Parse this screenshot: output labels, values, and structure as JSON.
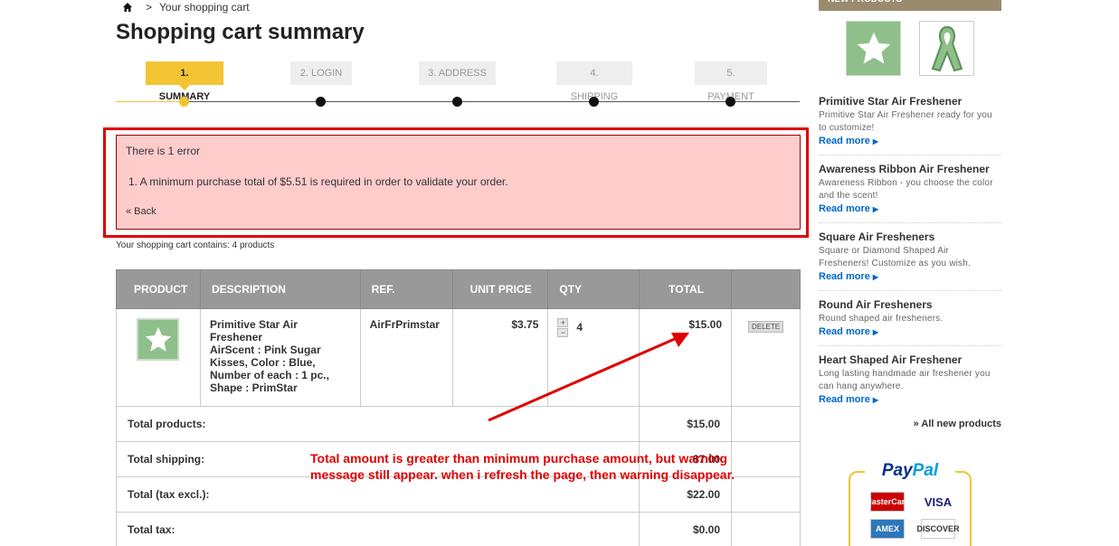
{
  "breadcrumb": {
    "separator": ">",
    "current": "Your shopping cart"
  },
  "page_title": "Shopping cart summary",
  "steps": [
    "1. SUMMARY",
    "2. LOGIN",
    "3. ADDRESS",
    "4. SHIPPING",
    "5. PAYMENT"
  ],
  "error": {
    "title": "There is 1 error",
    "item": "1.  A minimum purchase total of $5.51 is required in order to validate your order.",
    "back": "« Back"
  },
  "cart_count": "Your shopping cart contains: 4 products",
  "table": {
    "headers": [
      "PRODUCT",
      "DESCRIPTION",
      "REF.",
      "UNIT PRICE",
      "QTY",
      "TOTAL"
    ],
    "product": {
      "name": "Primitive Star Air Freshener",
      "attributes": "AirScent : Pink Sugar Kisses, Color : Blue, Number of each : 1 pc., Shape : PrimStar",
      "ref": "AirFrPrimstar",
      "unit_price": "$3.75",
      "qty": "4",
      "qty_plus": "+",
      "qty_minus": "−",
      "total": "$15.00",
      "delete": "DELETE"
    },
    "totals": [
      {
        "label": "Total products:",
        "value": "$15.00"
      },
      {
        "label": "Total shipping:",
        "value": "$7.00"
      },
      {
        "label": "Total (tax excl.):",
        "value": "$22.00"
      },
      {
        "label": "Total tax:",
        "value": "$0.00"
      }
    ]
  },
  "annotation": "Total amount is greater than minimum purchase amount, but warning message still appear. when i refresh the page, then warning disappear.",
  "sidebar": {
    "header": "NEW PRODUCTS",
    "items": [
      {
        "title": "Primitive Star Air Freshener",
        "desc": "Primitive Star Air Freshener ready for you to customize!",
        "more": "Read more"
      },
      {
        "title": "Awareness Ribbon Air Freshener",
        "desc": "Awareness Ribbon - you choose the color and the scent!",
        "more": "Read more"
      },
      {
        "title": "Square Air Fresheners",
        "desc": "Square or Diamond Shaped Air Fresheners! Customize as you wish.",
        "more": "Read more"
      },
      {
        "title": "Round Air Fresheners",
        "desc": "Round shaped air fresheners.",
        "more": "Read more"
      },
      {
        "title": "Heart Shaped Air Freshener",
        "desc": "Long lasting handmade air freshener you can hang anywhere.",
        "more": "Read more"
      }
    ],
    "all_new": "» All new products"
  },
  "paypal": {
    "pay": "Pay",
    "pal": "Pal",
    "cards": [
      "MasterCard",
      "VISA",
      "AMEX",
      "DISCOVER"
    ]
  },
  "colors": {
    "accent": "#f3c433",
    "error_bg": "#ffcccc",
    "annotation": "#e00000",
    "link": "#0066cc"
  }
}
